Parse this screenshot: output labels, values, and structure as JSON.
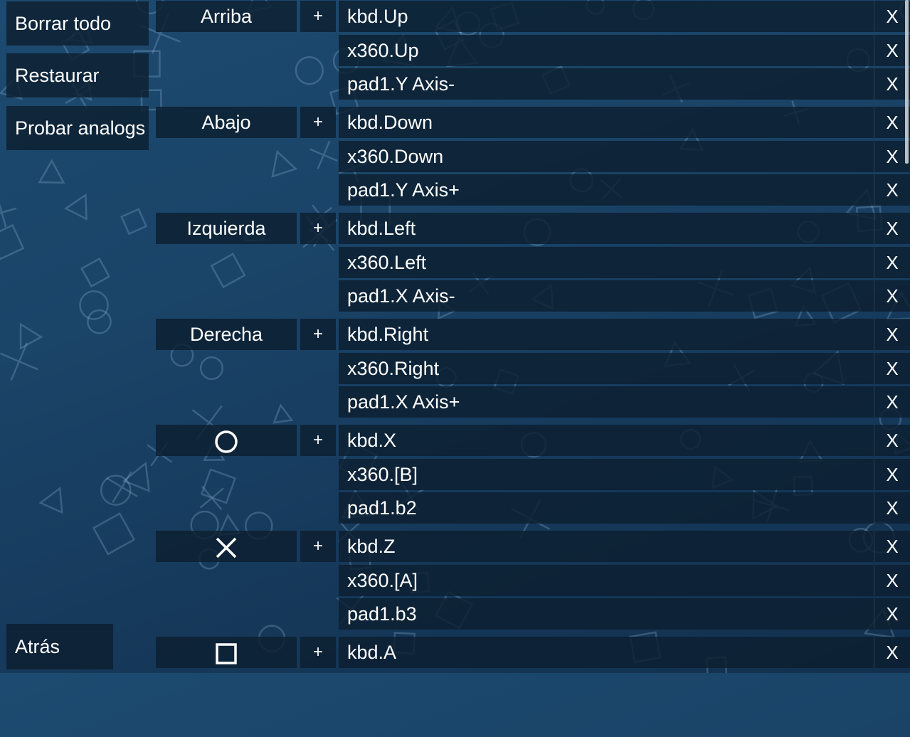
{
  "sidebar": {
    "clear_all": "Borrar todo",
    "restore": "Restaurar",
    "test_analogs": "Probar analogs",
    "back": "Atrás"
  },
  "add_label": "+",
  "delete_label": "X",
  "mappings": [
    {
      "label": "Arriba",
      "icon": "",
      "bindings": [
        "kbd.Up",
        "x360.Up",
        "pad1.Y Axis-"
      ]
    },
    {
      "label": "Abajo",
      "icon": "",
      "bindings": [
        "kbd.Down",
        "x360.Down",
        "pad1.Y Axis+"
      ]
    },
    {
      "label": "Izquierda",
      "icon": "",
      "bindings": [
        "kbd.Left",
        "x360.Left",
        "pad1.X Axis-"
      ]
    },
    {
      "label": "Derecha",
      "icon": "",
      "bindings": [
        "kbd.Right",
        "x360.Right",
        "pad1.X Axis+"
      ]
    },
    {
      "label": "",
      "icon": "circle-icon",
      "bindings": [
        "kbd.X",
        "x360.[B]",
        "pad1.b2"
      ]
    },
    {
      "label": "",
      "icon": "cross-icon",
      "bindings": [
        "kbd.Z",
        "x360.[A]",
        "pad1.b3"
      ]
    },
    {
      "label": "",
      "icon": "square-icon",
      "bindings": [
        "kbd.A"
      ]
    }
  ],
  "colors": {
    "background": "#1a4468",
    "cell": "#0c1e30",
    "text": "#ffffff"
  }
}
